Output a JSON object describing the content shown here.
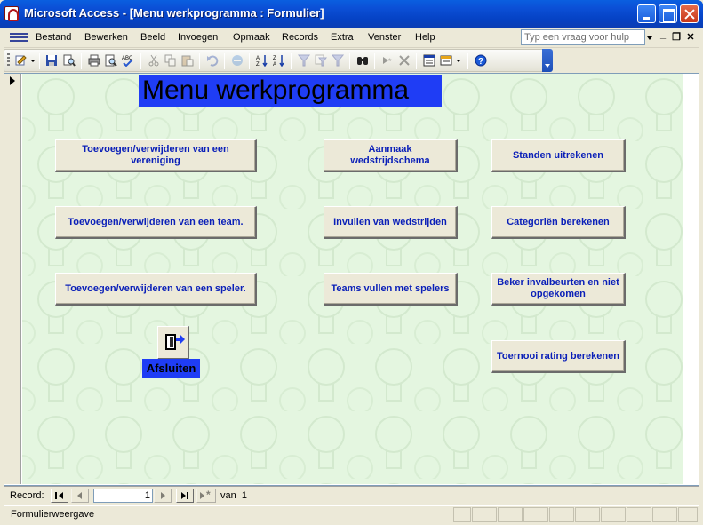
{
  "window": {
    "title": "Microsoft Access - [Menu werkprogramma : Formulier]"
  },
  "menubar": {
    "items": [
      "Bestand",
      "Bewerken",
      "Beeld",
      "Invoegen",
      "Opmaak",
      "Records",
      "Extra",
      "Venster",
      "Help"
    ],
    "help_placeholder": "Typ een vraag voor hulp"
  },
  "toolbar": {
    "buttons": [
      "view-icon",
      "save-icon",
      "file-search-icon",
      "print-icon",
      "print-preview-icon",
      "spelling-icon",
      "cut-icon",
      "copy-icon",
      "paste-icon",
      "undo-icon",
      "hyperlink-icon",
      "sort-ascending-icon",
      "sort-descending-icon",
      "filter-by-selection-icon",
      "filter-by-form-icon",
      "apply-filter-icon",
      "find-icon",
      "new-record-icon",
      "delete-record-icon",
      "properties-icon",
      "database-window-icon",
      "new-object-icon",
      "help-icon"
    ]
  },
  "form": {
    "heading": "Menu werkprogramma",
    "buttons": {
      "vereniging": "Toevoegen/verwijderen van een vereniging",
      "team": "Toevoegen/verwijderen van een team.",
      "speler": "Toevoegen/verwijderen van een speler.",
      "schema": "Aanmaak wedstrijdschema",
      "invullen": "Invullen van wedstrijden",
      "teams_vullen": "Teams vullen met spelers",
      "standen": "Standen uitrekenen",
      "categorien": "Categoriën berekenen",
      "beker": "Beker invalbeurten en niet opgekomen",
      "toernooi": "Toernooi rating berekenen"
    },
    "exit_label": "Afsluiten",
    "background_color": "#E4F6E0",
    "accent_color": "#1F3DF5"
  },
  "navigation": {
    "record_label": "Record:",
    "current_record": "1",
    "of_label": "van",
    "total_records": "1"
  },
  "status": {
    "text": "Formulierweergave"
  }
}
